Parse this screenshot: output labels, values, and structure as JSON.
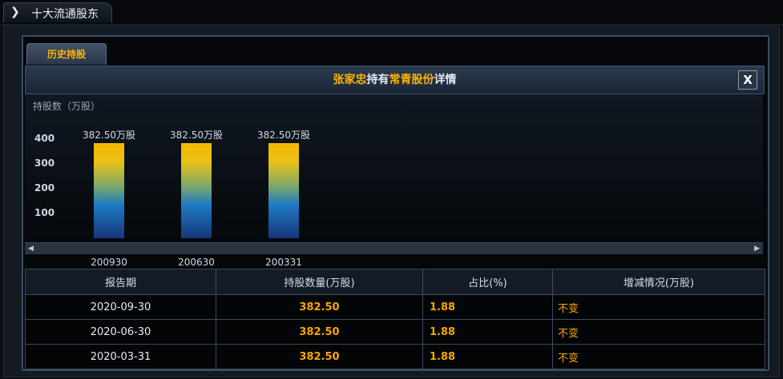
{
  "top_tab": {
    "icon": "chevron-right-icon",
    "title": "十大流通股东"
  },
  "history_tab": "历史持股",
  "header": {
    "holder": "张家忠",
    "verb": "持有",
    "stock": "常青股份",
    "suffix": "详情",
    "close_label": "X"
  },
  "chart_data": {
    "type": "bar",
    "ylabel": "持股数（万股）",
    "yticks": [
      "400",
      "300",
      "200",
      "100"
    ],
    "ylim": [
      0,
      400
    ],
    "categories": [
      "200930",
      "200630",
      "200331"
    ],
    "values": [
      382.5,
      382.5,
      382.5
    ],
    "data_labels": [
      "382.50万股",
      "382.50万股",
      "382.50万股"
    ],
    "colors": {
      "top": "#f5b800",
      "bottom": "#16367a"
    }
  },
  "table": {
    "headers": [
      "报告期",
      "持股数量(万股)",
      "占比(%)",
      "增减情况(万股)"
    ],
    "rows": [
      {
        "date": "2020-09-30",
        "shares": "382.50",
        "ratio": "1.88",
        "change": "不变"
      },
      {
        "date": "2020-06-30",
        "shares": "382.50",
        "ratio": "1.88",
        "change": "不变"
      },
      {
        "date": "2020-03-31",
        "shares": "382.50",
        "ratio": "1.88",
        "change": "不变"
      }
    ]
  },
  "colors": {
    "accent": "#ffb400",
    "panel_border": "#3b4d66",
    "background": "#05070a"
  }
}
